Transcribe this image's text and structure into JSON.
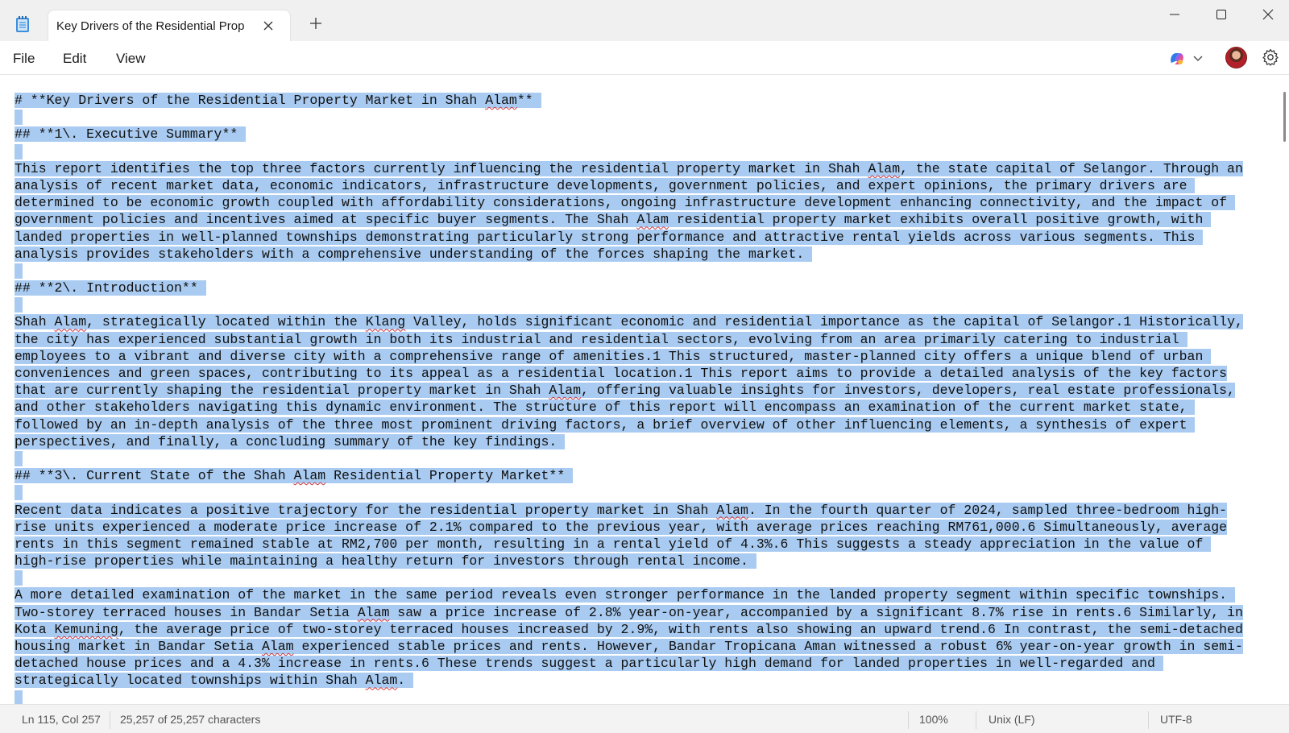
{
  "window": {
    "tab_title": "Key Drivers of the Residential Prop",
    "icons": {
      "app": "notepad-icon",
      "close_tab": "close-icon",
      "new_tab": "plus-icon",
      "minimize": "minimize-icon",
      "maximize": "maximize-icon",
      "close": "close-icon"
    }
  },
  "menu": {
    "file": "File",
    "edit": "Edit",
    "view": "View",
    "icons": {
      "copilot": "copilot-icon",
      "chevron": "chevron-down-icon",
      "avatar": "user-avatar",
      "settings": "gear-icon"
    }
  },
  "document": {
    "lines": [
      "# **Key Drivers of the Residential Property Market in Shah Alam** ",
      "",
      "## **1\\. Executive Summary** ",
      "",
      "This report identifies the top three factors currently influencing the residential property market in Shah Alam, the state capital of Selangor. Through an",
      "analysis of recent market data, economic indicators, infrastructure developments, government policies, and expert opinions, the primary drivers are ",
      "determined to be economic growth coupled with affordability considerations, ongoing infrastructure development enhancing connectivity, and the impact of ",
      "government policies and incentives aimed at specific buyer segments. The Shah Alam residential property market exhibits overall positive growth, with ",
      "landed properties in well-planned townships demonstrating particularly strong performance and attractive rental yields across various segments. This ",
      "analysis provides stakeholders with a comprehensive understanding of the forces shaping the market. ",
      "",
      "## **2\\. Introduction** ",
      "",
      "Shah Alam, strategically located within the Klang Valley, holds significant economic and residential importance as the capital of Selangor.1 Historically,",
      "the city has experienced substantial growth in both its industrial and residential sectors, evolving from an area primarily catering to industrial ",
      "employees to a vibrant and diverse city with a comprehensive range of amenities.1 This structured, master-planned city offers a unique blend of urban ",
      "conveniences and green spaces, contributing to its appeal as a residential location.1 This report aims to provide a detailed analysis of the key factors",
      "that are currently shaping the residential property market in Shah Alam, offering valuable insights for investors, developers, real estate professionals,",
      "and other stakeholders navigating this dynamic environment. The structure of this report will encompass an examination of the current market state, ",
      "followed by an in-depth analysis of the three most prominent driving factors, a brief overview of other influencing elements, a synthesis of expert ",
      "perspectives, and finally, a concluding summary of the key findings. ",
      "",
      "## **3\\. Current State of the Shah Alam Residential Property Market** ",
      "",
      "Recent data indicates a positive trajectory for the residential property market in Shah Alam. In the fourth quarter of 2024, sampled three-bedroom high-",
      "rise units experienced a moderate price increase of 2.1% compared to the previous year, with average prices reaching RM761,000.6 Simultaneously, average",
      "rents in this segment remained stable at RM2,700 per month, resulting in a rental yield of 4.3%.6 This suggests a steady appreciation in the value of ",
      "high-rise properties while maintaining a healthy return for investors through rental income. ",
      "",
      "A more detailed examination of the market in the same period reveals even stronger performance in the landed property segment within specific townships. ",
      "Two-storey terraced houses in Bandar Setia Alam saw a price increase of 2.8% year-on-year, accompanied by a significant 8.7% rise in rents.6 Similarly, in",
      "Kota Kemuning, the average price of two-storey terraced houses increased by 2.9%, with rents also showing an upward trend.6 In contrast, the semi-detached",
      "housing market in Bandar Setia Alam experienced stable prices and rents. However, Bandar Tropicana Aman witnessed a robust 6% year-on-year growth in semi-",
      "detached house prices and a 4.3% increase in rents.6 These trends suggest a particularly high demand for landed properties in well-regarded and ",
      "strategically located townships within Shah Alam. ",
      "",
      "                                                                                                                                                          "
    ],
    "misspelled": [
      "Alam",
      "Klang",
      "Kemuning"
    ]
  },
  "status": {
    "position": "Ln 115, Col 257",
    "characters": "25,257 of 25,257 characters",
    "zoom": "100%",
    "line_ending": "Unix (LF)",
    "encoding": "UTF-8"
  }
}
